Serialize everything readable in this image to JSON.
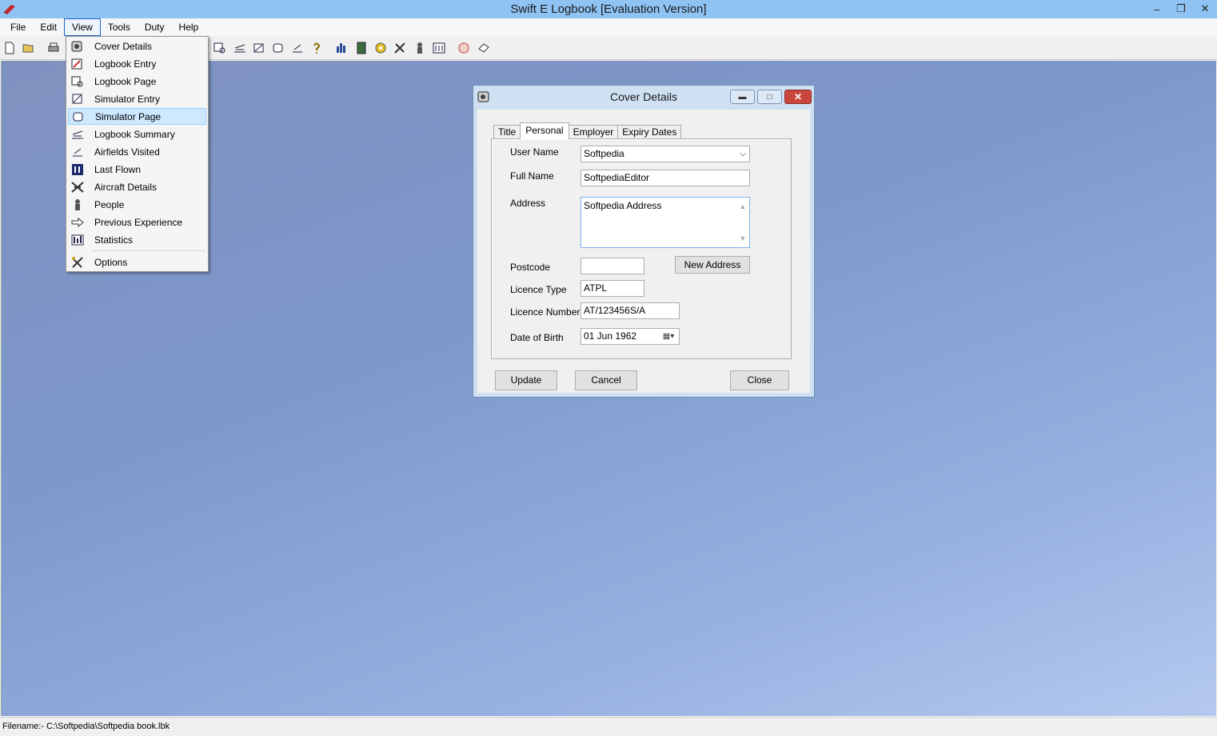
{
  "window": {
    "title": "Swift E Logbook [Evaluation Version]",
    "controls": [
      "minimize",
      "restore",
      "close"
    ]
  },
  "menubar": {
    "items": [
      {
        "label": "File"
      },
      {
        "label": "Edit"
      },
      {
        "label": "View"
      },
      {
        "label": "Tools"
      },
      {
        "label": "Duty"
      },
      {
        "label": "Help"
      }
    ]
  },
  "view_menu": {
    "items": [
      {
        "label": "Cover Details",
        "icon": "cover-details-icon"
      },
      {
        "label": "Logbook Entry",
        "icon": "logbook-entry-icon"
      },
      {
        "label": "Logbook Page",
        "icon": "logbook-page-icon"
      },
      {
        "label": "Simulator Entry",
        "icon": "simulator-entry-icon"
      },
      {
        "label": "Simulator Page",
        "icon": "simulator-page-icon",
        "highlighted": true
      },
      {
        "label": "Logbook Summary",
        "icon": "logbook-summary-icon"
      },
      {
        "label": "Airfields Visited",
        "icon": "airfields-icon"
      },
      {
        "label": "Last Flown",
        "icon": "last-flown-icon"
      },
      {
        "label": "Aircraft Details",
        "icon": "aircraft-icon"
      },
      {
        "label": "People",
        "icon": "people-icon"
      },
      {
        "label": "Previous Experience",
        "icon": "previous-experience-icon"
      },
      {
        "label": "Statistics",
        "icon": "statistics-icon"
      },
      {
        "label": "Options",
        "icon": "options-icon"
      }
    ]
  },
  "dialog": {
    "title": "Cover Details",
    "tabs": [
      {
        "label": "Title"
      },
      {
        "label": "Personal",
        "active": true
      },
      {
        "label": "Employer"
      },
      {
        "label": "Expiry Dates"
      }
    ],
    "fields": {
      "user_name": {
        "label": "User Name",
        "value": "Softpedia"
      },
      "full_name": {
        "label": "Full Name",
        "value": "SoftpediaEditor"
      },
      "address": {
        "label": "Address",
        "value": "Softpedia Address"
      },
      "postcode": {
        "label": "Postcode",
        "value": ""
      },
      "licence_type": {
        "label": "Licence Type",
        "value": "ATPL"
      },
      "licence_number": {
        "label": "Licence Number",
        "value": "AT/123456S/A"
      },
      "date_of_birth": {
        "label": "Date of Birth",
        "value": "01  Jun  1962"
      }
    },
    "new_address_label": "New Address",
    "buttons": {
      "update": "Update",
      "cancel": "Cancel",
      "close": "Close"
    }
  },
  "statusbar": {
    "text": "Filename:- C:\\Softpedia\\Softpedia book.lbk"
  },
  "colors": {
    "titlebar": "#8fc3f4",
    "menu_highlight": "#cde8ff",
    "desktop": "#7e98cc"
  }
}
